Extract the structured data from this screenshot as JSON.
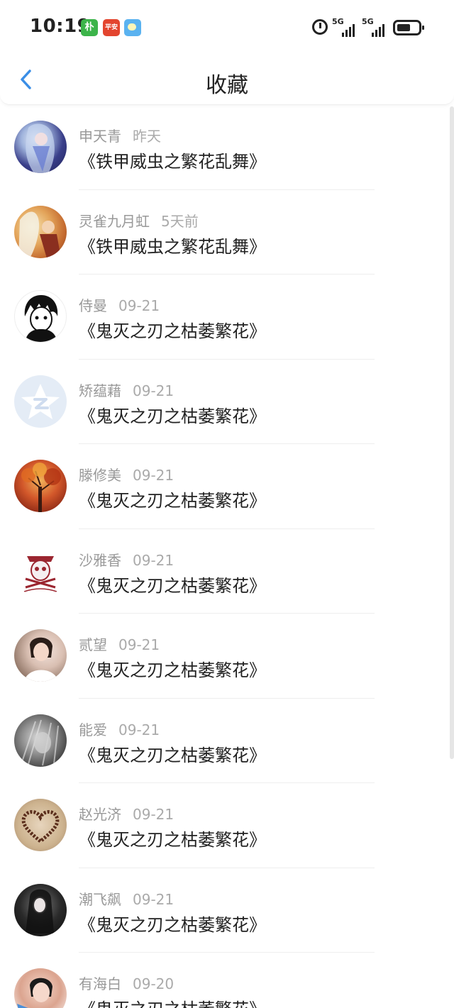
{
  "status_bar": {
    "time": "10:19",
    "app_icons": [
      "朴",
      "平安",
      ""
    ],
    "network": [
      "5G",
      "5G"
    ]
  },
  "header": {
    "title": "收藏"
  },
  "items": [
    {
      "name": "申天青",
      "time": "昨天",
      "work": "《铁甲威虫之繁花乱舞》"
    },
    {
      "name": "灵雀九月虹",
      "time": "5天前",
      "work": "《铁甲威虫之繁花乱舞》"
    },
    {
      "name": "侍曼",
      "time": "09-21",
      "work": "《鬼灭之刃之枯萎繁花》"
    },
    {
      "name": "矫蕴藉",
      "time": "09-21",
      "work": "《鬼灭之刃之枯萎繁花》"
    },
    {
      "name": "滕修美",
      "time": "09-21",
      "work": "《鬼灭之刃之枯萎繁花》"
    },
    {
      "name": "沙雅香",
      "time": "09-21",
      "work": "《鬼灭之刃之枯萎繁花》"
    },
    {
      "name": "贰望",
      "time": "09-21",
      "work": "《鬼灭之刃之枯萎繁花》"
    },
    {
      "name": "能爱",
      "time": "09-21",
      "work": "《鬼灭之刃之枯萎繁花》"
    },
    {
      "name": "赵光济",
      "time": "09-21",
      "work": "《鬼灭之刃之枯萎繁花》"
    },
    {
      "name": "潮飞飙",
      "time": "09-21",
      "work": "《鬼灭之刃之枯萎繁花》"
    },
    {
      "name": "有海白",
      "time": "09-20",
      "work": "《鬼灭之刃之枯萎繁花》"
    }
  ]
}
